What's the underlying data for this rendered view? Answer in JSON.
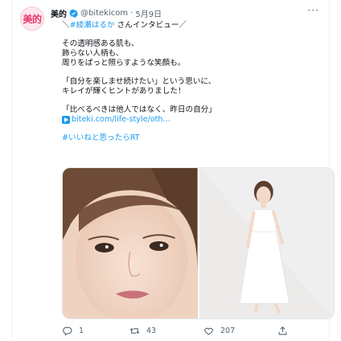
{
  "account": {
    "avatar_text": "美的",
    "name": "美的",
    "handle": "@bitekicom",
    "separator": "·",
    "date": "5月9日",
    "more": "···"
  },
  "tweet": {
    "line1_prefix": "＼",
    "hashtag1": "#綾瀬はるか",
    "line1_suffix": " さんインタビュー／",
    "p1": [
      "その透明感ある肌も、",
      "飾らない人柄も、",
      "周りをぱっと照らすような笑顔も。"
    ],
    "p2": [
      "「自分を楽しませ続けたい」という思いに、",
      "キレイが輝くヒントがありました！"
    ],
    "p3": "「比べるべきは他人ではなく、昨日の自分」",
    "link": "biteki.com/life-style/oth…",
    "hashtag2": "#いいねと思ったらRT"
  },
  "metrics": {
    "replies": "1",
    "retweets": "43",
    "likes": "207"
  },
  "icons": {
    "verified": "verified-badge-icon",
    "reply": "reply-icon",
    "retweet": "retweet-icon",
    "like": "heart-icon",
    "share": "share-icon",
    "link": "link-play-icon"
  },
  "colors": {
    "accent": "#1d9bf0",
    "brand": "#e5366a",
    "muted": "#536471"
  }
}
